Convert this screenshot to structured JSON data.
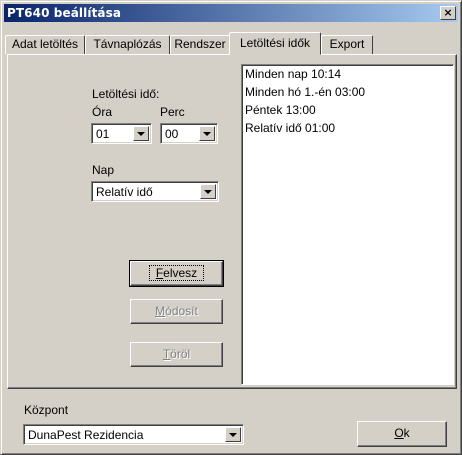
{
  "window": {
    "title": "PT640 beállítása",
    "close_symbol": "×"
  },
  "tabs": [
    {
      "label": "Adat letöltés",
      "active": false
    },
    {
      "label": "Távnaplózás",
      "active": false
    },
    {
      "label": "Rendszer",
      "active": false
    },
    {
      "label": "Letöltési idők",
      "active": true
    },
    {
      "label": "Export",
      "active": false
    }
  ],
  "form": {
    "download_time_label": "Letöltési idő:",
    "hour_label": "Óra",
    "minute_label": "Perc",
    "hour_value": "01",
    "minute_value": "00",
    "day_label": "Nap",
    "day_value": "Relatív idő"
  },
  "schedule_list": [
    "Minden nap 10:14",
    "Minden hó 1.-én 03:00",
    "Péntek 13:00",
    "Relatív idő 01:00"
  ],
  "buttons": {
    "add": {
      "first": "F",
      "rest": "elvesz",
      "enabled": true
    },
    "modify": {
      "first": "M",
      "rest": "ódosít",
      "enabled": false
    },
    "delete": {
      "first": "T",
      "rest": "öröl",
      "enabled": false
    },
    "ok": {
      "first": "O",
      "rest": "k",
      "enabled": true
    }
  },
  "footer": {
    "center_label": "Központ",
    "center_value": "DunaPest Rezidencia"
  }
}
